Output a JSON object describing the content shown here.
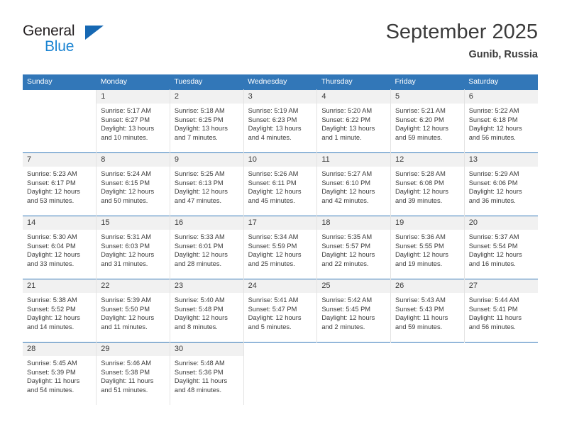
{
  "brand": {
    "name_top": "General",
    "name_bottom": "Blue",
    "triangle_color": "#1668b3",
    "blue_color": "#1b84d2"
  },
  "header": {
    "title": "September 2025",
    "subtitle": "Gunib, Russia"
  },
  "theme": {
    "header_blue": "#3277b8",
    "daynum_bg": "#f1f1f1",
    "text": "#3b3b3b"
  },
  "weekday_headers": [
    "Sunday",
    "Monday",
    "Tuesday",
    "Wednesday",
    "Thursday",
    "Friday",
    "Saturday"
  ],
  "weeks": [
    [
      {
        "day": "",
        "sunrise": "",
        "sunset": "",
        "daylight1": "",
        "daylight2": ""
      },
      {
        "day": "1",
        "sunrise": "Sunrise: 5:17 AM",
        "sunset": "Sunset: 6:27 PM",
        "daylight1": "Daylight: 13 hours",
        "daylight2": "and 10 minutes."
      },
      {
        "day": "2",
        "sunrise": "Sunrise: 5:18 AM",
        "sunset": "Sunset: 6:25 PM",
        "daylight1": "Daylight: 13 hours",
        "daylight2": "and 7 minutes."
      },
      {
        "day": "3",
        "sunrise": "Sunrise: 5:19 AM",
        "sunset": "Sunset: 6:23 PM",
        "daylight1": "Daylight: 13 hours",
        "daylight2": "and 4 minutes."
      },
      {
        "day": "4",
        "sunrise": "Sunrise: 5:20 AM",
        "sunset": "Sunset: 6:22 PM",
        "daylight1": "Daylight: 13 hours",
        "daylight2": "and 1 minute."
      },
      {
        "day": "5",
        "sunrise": "Sunrise: 5:21 AM",
        "sunset": "Sunset: 6:20 PM",
        "daylight1": "Daylight: 12 hours",
        "daylight2": "and 59 minutes."
      },
      {
        "day": "6",
        "sunrise": "Sunrise: 5:22 AM",
        "sunset": "Sunset: 6:18 PM",
        "daylight1": "Daylight: 12 hours",
        "daylight2": "and 56 minutes."
      }
    ],
    [
      {
        "day": "7",
        "sunrise": "Sunrise: 5:23 AM",
        "sunset": "Sunset: 6:17 PM",
        "daylight1": "Daylight: 12 hours",
        "daylight2": "and 53 minutes."
      },
      {
        "day": "8",
        "sunrise": "Sunrise: 5:24 AM",
        "sunset": "Sunset: 6:15 PM",
        "daylight1": "Daylight: 12 hours",
        "daylight2": "and 50 minutes."
      },
      {
        "day": "9",
        "sunrise": "Sunrise: 5:25 AM",
        "sunset": "Sunset: 6:13 PM",
        "daylight1": "Daylight: 12 hours",
        "daylight2": "and 47 minutes."
      },
      {
        "day": "10",
        "sunrise": "Sunrise: 5:26 AM",
        "sunset": "Sunset: 6:11 PM",
        "daylight1": "Daylight: 12 hours",
        "daylight2": "and 45 minutes."
      },
      {
        "day": "11",
        "sunrise": "Sunrise: 5:27 AM",
        "sunset": "Sunset: 6:10 PM",
        "daylight1": "Daylight: 12 hours",
        "daylight2": "and 42 minutes."
      },
      {
        "day": "12",
        "sunrise": "Sunrise: 5:28 AM",
        "sunset": "Sunset: 6:08 PM",
        "daylight1": "Daylight: 12 hours",
        "daylight2": "and 39 minutes."
      },
      {
        "day": "13",
        "sunrise": "Sunrise: 5:29 AM",
        "sunset": "Sunset: 6:06 PM",
        "daylight1": "Daylight: 12 hours",
        "daylight2": "and 36 minutes."
      }
    ],
    [
      {
        "day": "14",
        "sunrise": "Sunrise: 5:30 AM",
        "sunset": "Sunset: 6:04 PM",
        "daylight1": "Daylight: 12 hours",
        "daylight2": "and 33 minutes."
      },
      {
        "day": "15",
        "sunrise": "Sunrise: 5:31 AM",
        "sunset": "Sunset: 6:03 PM",
        "daylight1": "Daylight: 12 hours",
        "daylight2": "and 31 minutes."
      },
      {
        "day": "16",
        "sunrise": "Sunrise: 5:33 AM",
        "sunset": "Sunset: 6:01 PM",
        "daylight1": "Daylight: 12 hours",
        "daylight2": "and 28 minutes."
      },
      {
        "day": "17",
        "sunrise": "Sunrise: 5:34 AM",
        "sunset": "Sunset: 5:59 PM",
        "daylight1": "Daylight: 12 hours",
        "daylight2": "and 25 minutes."
      },
      {
        "day": "18",
        "sunrise": "Sunrise: 5:35 AM",
        "sunset": "Sunset: 5:57 PM",
        "daylight1": "Daylight: 12 hours",
        "daylight2": "and 22 minutes."
      },
      {
        "day": "19",
        "sunrise": "Sunrise: 5:36 AM",
        "sunset": "Sunset: 5:55 PM",
        "daylight1": "Daylight: 12 hours",
        "daylight2": "and 19 minutes."
      },
      {
        "day": "20",
        "sunrise": "Sunrise: 5:37 AM",
        "sunset": "Sunset: 5:54 PM",
        "daylight1": "Daylight: 12 hours",
        "daylight2": "and 16 minutes."
      }
    ],
    [
      {
        "day": "21",
        "sunrise": "Sunrise: 5:38 AM",
        "sunset": "Sunset: 5:52 PM",
        "daylight1": "Daylight: 12 hours",
        "daylight2": "and 14 minutes."
      },
      {
        "day": "22",
        "sunrise": "Sunrise: 5:39 AM",
        "sunset": "Sunset: 5:50 PM",
        "daylight1": "Daylight: 12 hours",
        "daylight2": "and 11 minutes."
      },
      {
        "day": "23",
        "sunrise": "Sunrise: 5:40 AM",
        "sunset": "Sunset: 5:48 PM",
        "daylight1": "Daylight: 12 hours",
        "daylight2": "and 8 minutes."
      },
      {
        "day": "24",
        "sunrise": "Sunrise: 5:41 AM",
        "sunset": "Sunset: 5:47 PM",
        "daylight1": "Daylight: 12 hours",
        "daylight2": "and 5 minutes."
      },
      {
        "day": "25",
        "sunrise": "Sunrise: 5:42 AM",
        "sunset": "Sunset: 5:45 PM",
        "daylight1": "Daylight: 12 hours",
        "daylight2": "and 2 minutes."
      },
      {
        "day": "26",
        "sunrise": "Sunrise: 5:43 AM",
        "sunset": "Sunset: 5:43 PM",
        "daylight1": "Daylight: 11 hours",
        "daylight2": "and 59 minutes."
      },
      {
        "day": "27",
        "sunrise": "Sunrise: 5:44 AM",
        "sunset": "Sunset: 5:41 PM",
        "daylight1": "Daylight: 11 hours",
        "daylight2": "and 56 minutes."
      }
    ],
    [
      {
        "day": "28",
        "sunrise": "Sunrise: 5:45 AM",
        "sunset": "Sunset: 5:39 PM",
        "daylight1": "Daylight: 11 hours",
        "daylight2": "and 54 minutes."
      },
      {
        "day": "29",
        "sunrise": "Sunrise: 5:46 AM",
        "sunset": "Sunset: 5:38 PM",
        "daylight1": "Daylight: 11 hours",
        "daylight2": "and 51 minutes."
      },
      {
        "day": "30",
        "sunrise": "Sunrise: 5:48 AM",
        "sunset": "Sunset: 5:36 PM",
        "daylight1": "Daylight: 11 hours",
        "daylight2": "and 48 minutes."
      },
      {
        "day": "",
        "sunrise": "",
        "sunset": "",
        "daylight1": "",
        "daylight2": ""
      },
      {
        "day": "",
        "sunrise": "",
        "sunset": "",
        "daylight1": "",
        "daylight2": ""
      },
      {
        "day": "",
        "sunrise": "",
        "sunset": "",
        "daylight1": "",
        "daylight2": ""
      },
      {
        "day": "",
        "sunrise": "",
        "sunset": "",
        "daylight1": "",
        "daylight2": ""
      }
    ]
  ]
}
